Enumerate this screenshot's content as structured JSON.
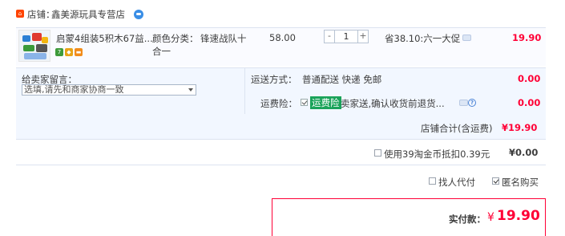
{
  "shop": {
    "label": "店铺：",
    "name": "鑫美源玩具专营店"
  },
  "item": {
    "title": "启蒙4组装5积木67益...",
    "sku_label": "颜色分类：",
    "sku_value_line1": "锋速战队十",
    "sku_value_line2": "合一",
    "price": "58.00",
    "quantity": "1",
    "qty_minus": "-",
    "qty_plus": "+",
    "promo": "省38.10:六一大促",
    "total": "19.90",
    "badges": [
      "7",
      "",
      ""
    ]
  },
  "message": {
    "label": "给卖家留言：",
    "placeholder": "选填,请先和商家协商一致"
  },
  "shipping": {
    "label": "运送方式：",
    "method": "普通配送 快递 免邮",
    "fee": "0.00"
  },
  "insurance": {
    "label": "运费险：",
    "highlight": "运费险",
    "desc": "卖家送,确认收货前退货...",
    "help": "?",
    "fee": "0.00"
  },
  "subtotal": {
    "label": "店铺合计(含运费)",
    "value": "¥19.90"
  },
  "taojinbi": {
    "text": "使用39淘金币抵扣0.39元",
    "value": "¥0.00"
  },
  "options": {
    "proxy_pay": "找人代付",
    "anonymous": "匿名购买"
  },
  "payment": {
    "label": "实付款：",
    "currency": "¥",
    "value": "19.90"
  },
  "colors": {
    "price_red": "#ff0036",
    "panel_bg": "#f2f7ff",
    "insurance_green": "#1aa35a"
  }
}
